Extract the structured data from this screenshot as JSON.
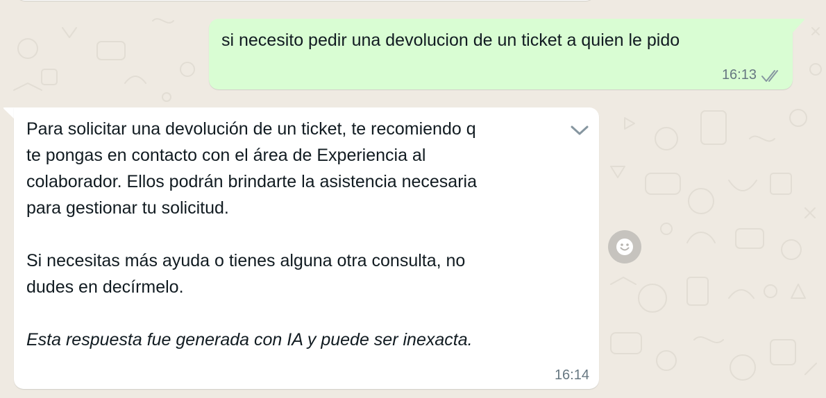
{
  "chat": {
    "outgoing": {
      "text": "si necesito pedir una devolucion de un ticket a quien le pido",
      "time": "16:13",
      "status": "read",
      "ticks_icon": "double-check-icon"
    },
    "incoming": {
      "paragraph_1": "Para solicitar una devolución de un ticket, te recomiendo q\nte pongas en contacto con el área de Experiencia al\ncolaborador. Ellos podrán brindarte la asistencia necesaria\npara gestionar tu solicitud.",
      "paragraph_2": "Si necesitas más ayuda o tienes alguna otra consulta, no\ndudes en decírmelo.",
      "disclaimer": "Esta respuesta fue generada con IA y puede ser inexacta.",
      "time": "16:14",
      "menu_icon": "chevron-down-icon"
    },
    "reaction_icon": "smiley-icon"
  },
  "colors": {
    "wallpaper": "#efeae2",
    "outgoing_bubble": "#d9fdd3",
    "incoming_bubble": "#ffffff",
    "text": "#111b21",
    "meta_text": "#667781"
  }
}
